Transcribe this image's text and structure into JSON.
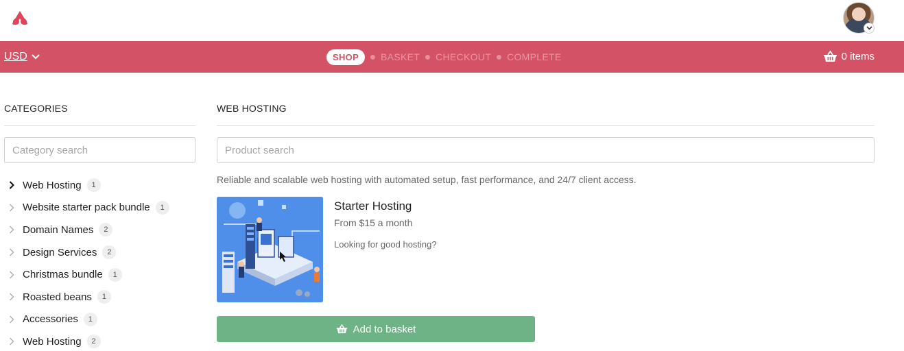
{
  "header": {
    "logo_icon": "app-logo-icon",
    "avatar_icon": "user-avatar",
    "colors": {
      "brand": "#d45266",
      "accent_green": "#6db386"
    }
  },
  "toolbar": {
    "currency": "USD",
    "steps": {
      "shop": "SHOP",
      "basket": "BASKET",
      "checkout": "CHECKOUT",
      "complete": "COMPLETE"
    },
    "basket_items": "0 items"
  },
  "sidebar": {
    "title": "CATEGORIES",
    "search_placeholder": "Category search",
    "items": [
      {
        "label": "Web Hosting",
        "count": "1",
        "active": true
      },
      {
        "label": "Website starter pack bundle",
        "count": "1",
        "active": false
      },
      {
        "label": "Domain Names",
        "count": "2",
        "active": false
      },
      {
        "label": "Design Services",
        "count": "2",
        "active": false
      },
      {
        "label": "Christmas bundle",
        "count": "1",
        "active": false
      },
      {
        "label": "Roasted beans",
        "count": "1",
        "active": false
      },
      {
        "label": "Accessories",
        "count": "1",
        "active": false
      },
      {
        "label": "Web Hosting",
        "count": "2",
        "active": false
      }
    ]
  },
  "main": {
    "title": "WEB HOSTING",
    "search_placeholder": "Product search",
    "description": "Reliable and scalable web hosting with automated setup, fast performance, and 24/7 client access.",
    "product": {
      "title": "Starter Hosting",
      "price": "From $15 a month",
      "blurb": "Looking for good hosting?",
      "add_label": "Add to basket"
    }
  }
}
